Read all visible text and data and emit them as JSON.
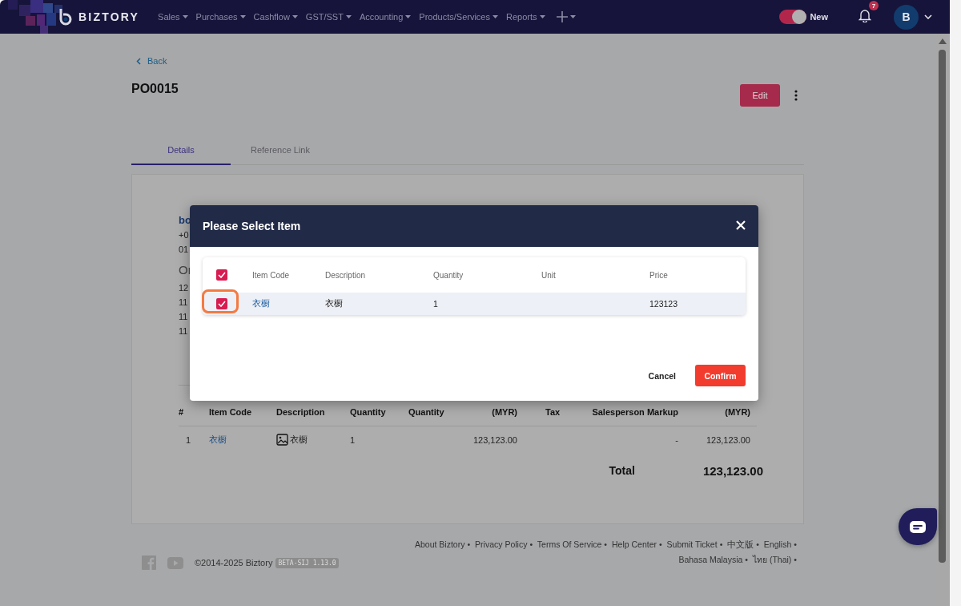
{
  "nav": {
    "brand": "BIZTORY",
    "menus": [
      "Sales",
      "Purchases",
      "Cashflow",
      "GST/SST",
      "Accounting",
      "Products/Services",
      "Reports"
    ],
    "toggle": {
      "label": "New",
      "on": true
    },
    "notification_count": "7",
    "avatar": "B"
  },
  "page": {
    "back": "Back",
    "title": "PO0015",
    "edit": "Edit",
    "tabs": [
      {
        "label": "Details",
        "selected": true
      },
      {
        "label": "Reference Link",
        "selected": false
      }
    ],
    "partial_texts": [
      {
        "kind": "name",
        "text": "bo"
      },
      {
        "kind": "line",
        "text": "+0"
      },
      {
        "kind": "line",
        "text": "01"
      },
      {
        "kind": "heading",
        "text": "Or"
      },
      {
        "kind": "line",
        "text": "12"
      },
      {
        "kind": "line",
        "text": "11"
      },
      {
        "kind": "line",
        "text": "11"
      },
      {
        "kind": "line",
        "text": "11"
      }
    ],
    "items_table": {
      "columns": [
        "#",
        "Item Code",
        "Description",
        "Quantity",
        "Quantity",
        "(MYR)",
        "Tax",
        "Salesperson Markup",
        "(MYR)"
      ],
      "rows": [
        {
          "no": "1",
          "item_code": "衣橱",
          "description": "衣橱",
          "quantity": "1",
          "price": "123,123.00",
          "markup": "-",
          "amount": "123,123.00"
        }
      ]
    },
    "total_label": "Total",
    "total": "123,123.00"
  },
  "modal": {
    "title": "Please Select Item",
    "select_all": {
      "checked": true
    },
    "columns": [
      "Item Code",
      "Description",
      "Quantity",
      "Unit",
      "Price"
    ],
    "rows": [
      {
        "checked": true,
        "highlighted": true,
        "item_code": "衣橱",
        "description": "衣橱",
        "quantity": "1",
        "price": "123123"
      }
    ],
    "cancel": "Cancel",
    "confirm": "Confirm"
  },
  "footer": {
    "copyright": "©2014-2025 Biztory",
    "version": "BETA-SIJ 1.13.0",
    "links": [
      {
        "label": "About Biztory",
        "sep": "•"
      },
      {
        "label": "Privacy Policy",
        "sep": "•"
      },
      {
        "label": "Terms Of Service",
        "sep": "•"
      },
      {
        "label": "Help Center",
        "sep": "•"
      },
      {
        "label": "Submit Ticket",
        "sep": "•"
      },
      {
        "label": "中文版",
        "sep": "•"
      },
      {
        "label": "English",
        "sep": "•"
      },
      {
        "label": "Bahasa Malaysia",
        "sep": "•"
      },
      {
        "label": "ไทย (Thai)",
        "sep": "•"
      }
    ]
  }
}
